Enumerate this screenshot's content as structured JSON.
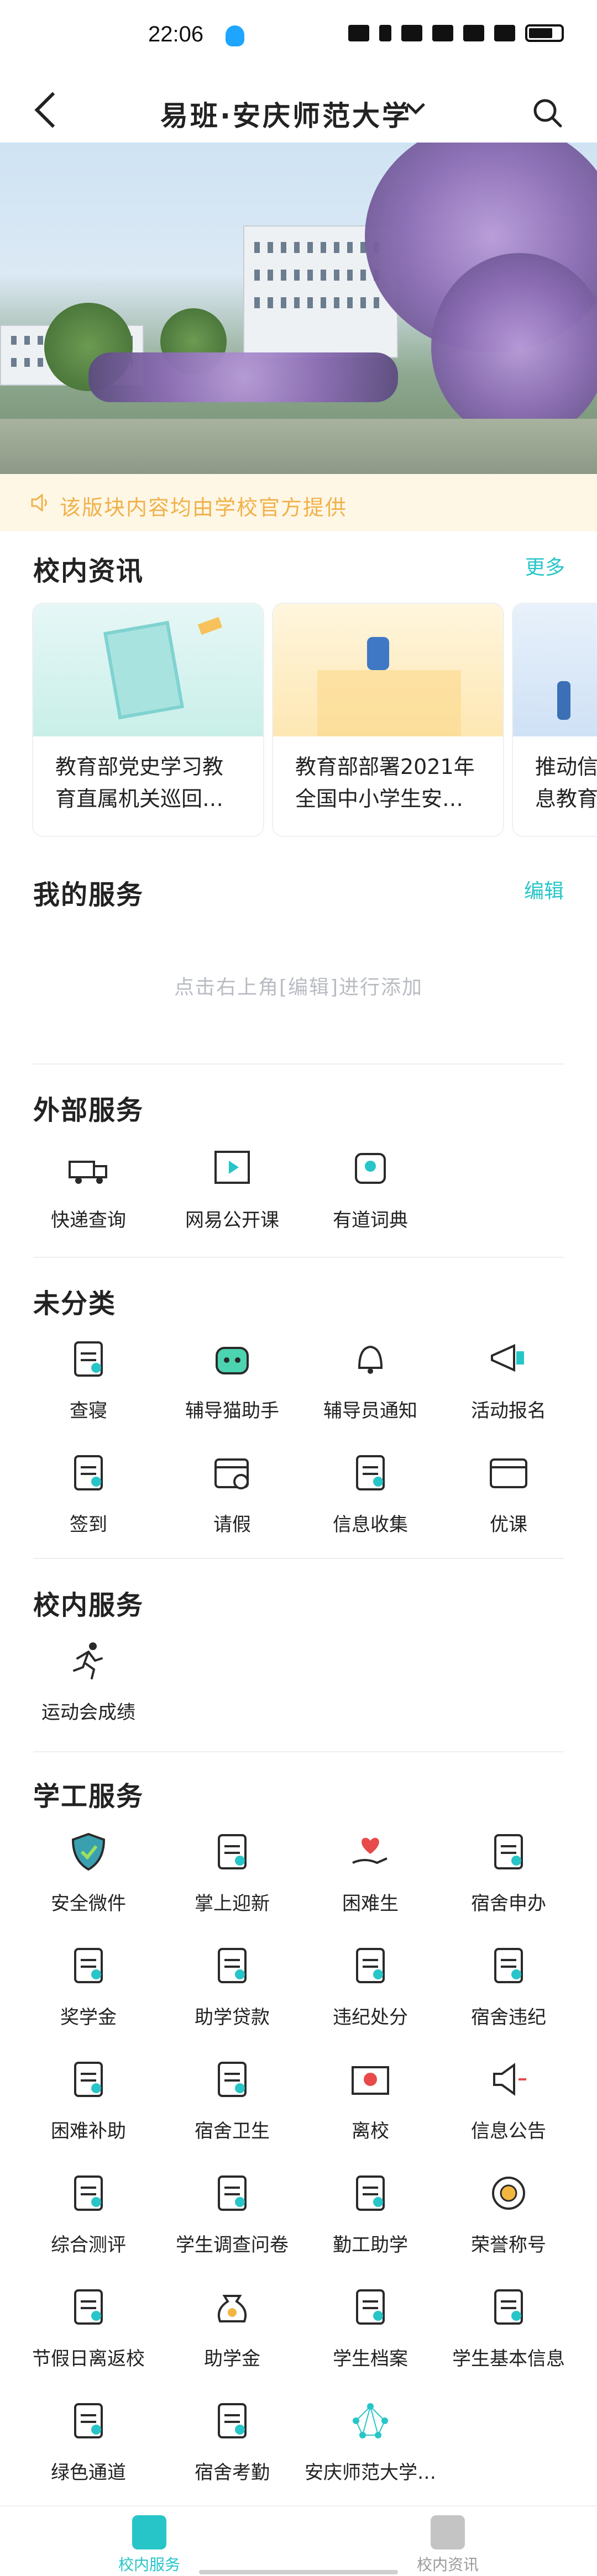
{
  "status_bar": {
    "time": "22:06"
  },
  "nav": {
    "title": "易班·安庆师范大学"
  },
  "notice": {
    "text": "该版块内容均由学校官方提供"
  },
  "news": {
    "title": "校内资讯",
    "more": "更多",
    "cards": [
      {
        "title": "教育部党史学习教育直属机关巡回…"
      },
      {
        "title": "教育部部署2021年全国中小学生安…"
      },
      {
        "title": "推动信息教育"
      }
    ]
  },
  "my_services": {
    "title": "我的服务",
    "edit": "编辑",
    "placeholder": "点击右上角[编辑]进行添加"
  },
  "external": {
    "title": "外部服务",
    "items": [
      {
        "label": "快递查询",
        "icon": "truck-icon"
      },
      {
        "label": "网易公开课",
        "icon": "play-icon"
      },
      {
        "label": "有道词典",
        "icon": "dictionary-icon"
      }
    ]
  },
  "uncategorized": {
    "title": "未分类",
    "items": [
      {
        "label": "查寝",
        "icon": "dorm-check-icon"
      },
      {
        "label": "辅导猫助手",
        "icon": "robot-icon"
      },
      {
        "label": "辅导员通知",
        "icon": "bell-icon"
      },
      {
        "label": "活动报名",
        "icon": "megaphone-icon"
      },
      {
        "label": "签到",
        "icon": "checkin-icon"
      },
      {
        "label": "请假",
        "icon": "calendar-icon"
      },
      {
        "label": "信息收集",
        "icon": "form-icon"
      },
      {
        "label": "优课",
        "icon": "course-icon"
      }
    ]
  },
  "campus": {
    "title": "校内服务",
    "items": [
      {
        "label": "运动会成绩",
        "icon": "runner-icon"
      }
    ]
  },
  "student_affairs": {
    "title": "学工服务",
    "items": [
      {
        "label": "安全微件",
        "icon": "shield-icon"
      },
      {
        "label": "掌上迎新",
        "icon": "id-card-icon"
      },
      {
        "label": "困难生",
        "icon": "heart-hand-icon"
      },
      {
        "label": "宿舍申办",
        "icon": "clipboard-icon"
      },
      {
        "label": "奖学金",
        "icon": "scholarship-icon"
      },
      {
        "label": "助学贷款",
        "icon": "loan-icon"
      },
      {
        "label": "违纪处分",
        "icon": "edit-doc-icon"
      },
      {
        "label": "宿舍违纪",
        "icon": "eye-doc-icon"
      },
      {
        "label": "困难补助",
        "icon": "subsidy-icon"
      },
      {
        "label": "宿舍卫生",
        "icon": "hygiene-icon"
      },
      {
        "label": "离校",
        "icon": "envelope-icon"
      },
      {
        "label": "信息公告",
        "icon": "speaker-icon"
      },
      {
        "label": "综合测评",
        "icon": "assessment-icon"
      },
      {
        "label": "学生调查问卷",
        "icon": "survey-icon"
      },
      {
        "label": "勤工助学",
        "icon": "search-doc-icon"
      },
      {
        "label": "荣誉称号",
        "icon": "medal-icon"
      },
      {
        "label": "节假日离返校",
        "icon": "holiday-icon"
      },
      {
        "label": "助学金",
        "icon": "money-bag-icon"
      },
      {
        "label": "学生档案",
        "icon": "archive-icon"
      },
      {
        "label": "学生基本信息",
        "icon": "profile-icon"
      },
      {
        "label": "绿色通道",
        "icon": "green-channel-icon"
      },
      {
        "label": "宿舍考勤",
        "icon": "attendance-icon"
      },
      {
        "label": "安庆师范大学…",
        "icon": "network-icon"
      }
    ]
  },
  "tabbar": {
    "tabs": [
      {
        "label": "校内服务",
        "color": "#27c5c8"
      },
      {
        "label": "校内资讯",
        "color": "#9a9a9a"
      }
    ]
  }
}
